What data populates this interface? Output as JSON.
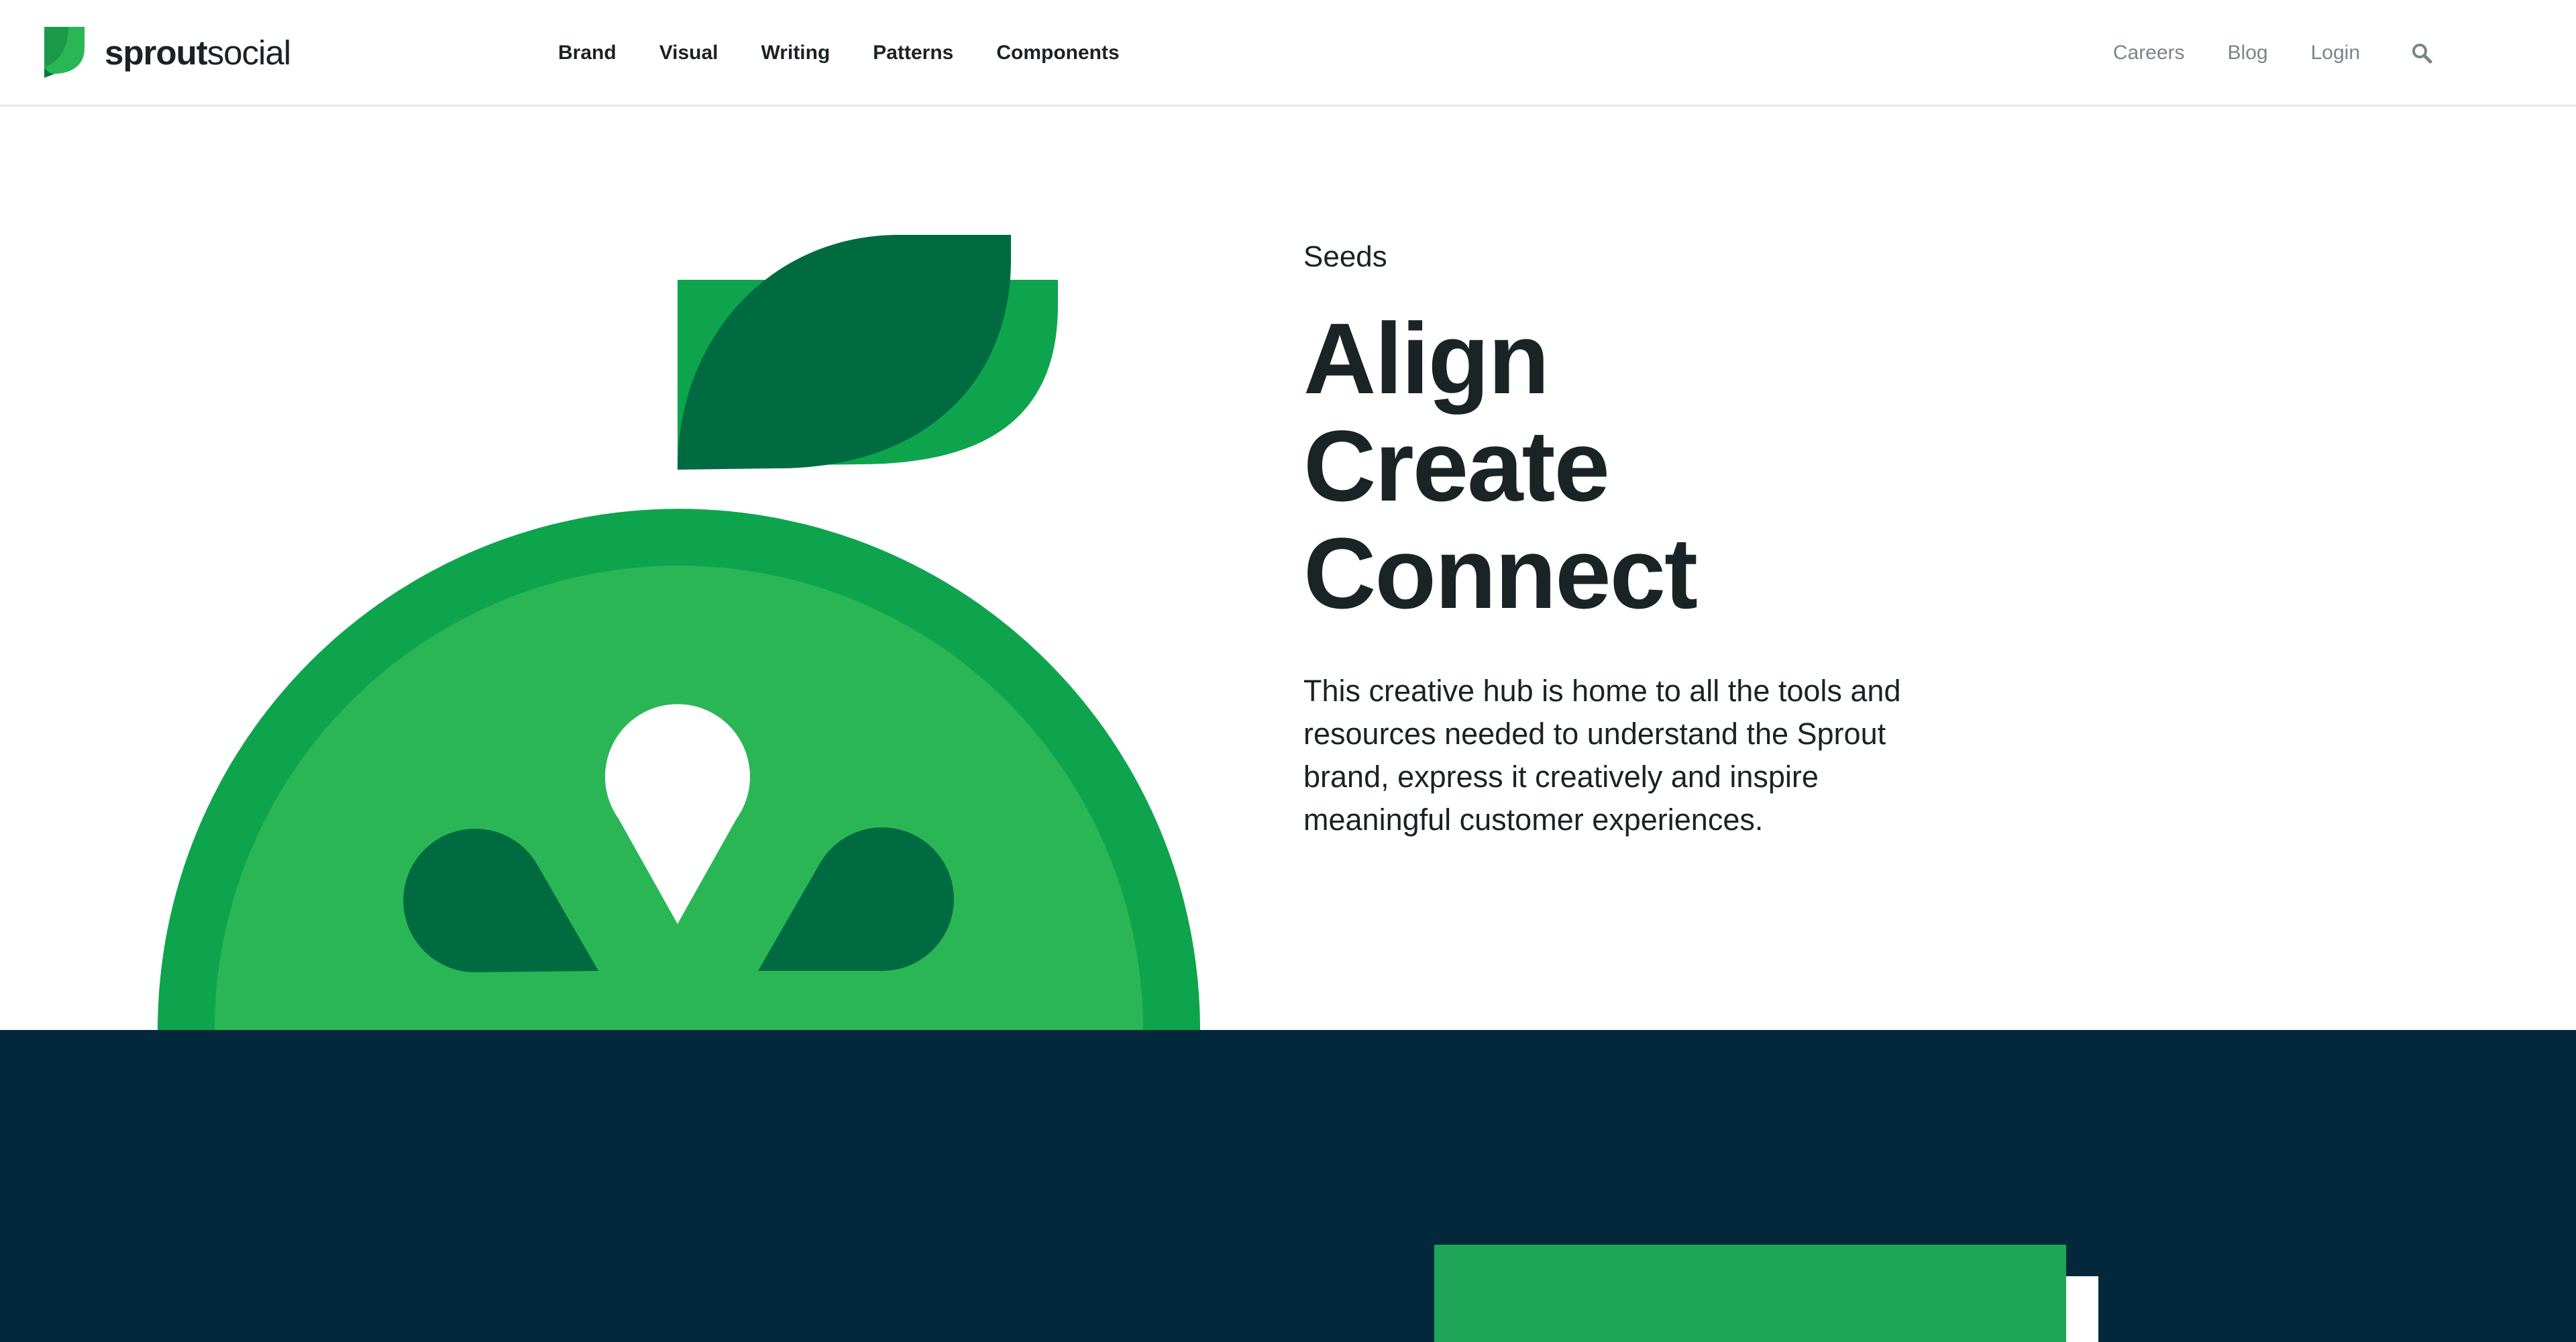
{
  "brand": {
    "name_bold": "sprout",
    "name_light": "social",
    "logo_icon": "sprout-leaf-logo"
  },
  "nav": {
    "main": [
      "Brand",
      "Visual",
      "Writing",
      "Patterns",
      "Components"
    ],
    "secondary": [
      "Careers",
      "Blog",
      "Login"
    ],
    "search_icon": "search-icon"
  },
  "hero": {
    "eyebrow": "Seeds",
    "headline": [
      "Align",
      "Create",
      "Connect"
    ],
    "description": "This creative hub is home to all the tools and resources needed to understand the Sprout brand, express it creatively and inspire meaningful customer experiences.",
    "illustration": "sprouting-seed-icon"
  },
  "colors": {
    "green_dark": "#006b40",
    "green_mid": "#0ea44d",
    "green_light": "#2bb656",
    "navy": "#03283b",
    "text": "#1b2226",
    "muted": "#7a8588"
  }
}
